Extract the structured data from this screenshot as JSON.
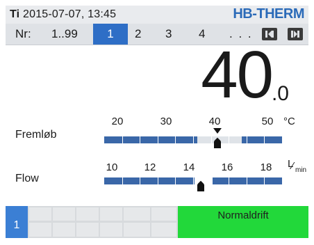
{
  "header": {
    "day": "Ti",
    "datetime": "2015-07-07, 13:45",
    "brand": "HB-THERM"
  },
  "nav": {
    "label": "Nr:",
    "range": "1..99",
    "active": "1",
    "items": [
      "2",
      "3",
      "4"
    ],
    "ellipsis": ". . .",
    "prev_icon": "page-back-icon",
    "next_icon": "page-forward-icon"
  },
  "display": {
    "value": "40",
    "decimal": ".0"
  },
  "temperature": {
    "label": "Fremløb",
    "ticks": [
      "20",
      "30",
      "40",
      "50"
    ],
    "unit": "°C",
    "current": 40.0,
    "setpoint": 40
  },
  "flow": {
    "label": "Flow",
    "ticks": [
      "10",
      "12",
      "14",
      "16",
      "18"
    ],
    "unit_num": "L",
    "unit_den": "min",
    "current": 14.6
  },
  "statusbar": {
    "channel": "1",
    "status": "Normaldrift"
  },
  "colors": {
    "brand": "#2a6ab8",
    "active_tab": "#2e6ec6",
    "bar": "#3a67a8",
    "status_ok": "#22d83a"
  }
}
